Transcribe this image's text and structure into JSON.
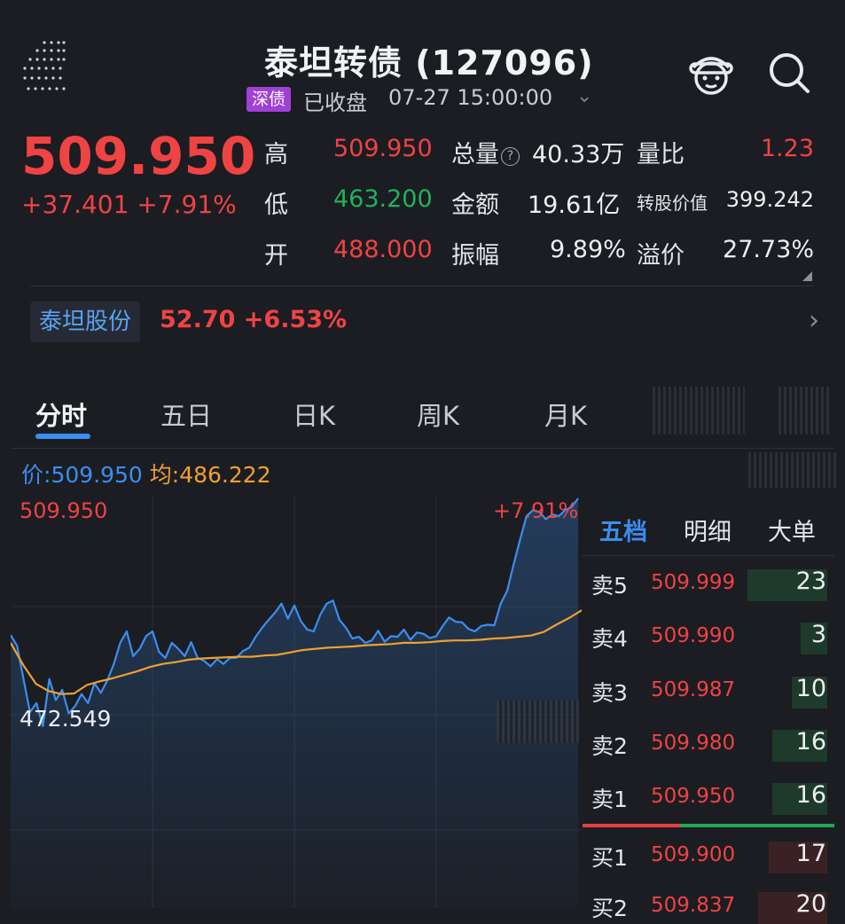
{
  "header": {
    "title": "泰坦转债 (127096)",
    "market_tag": "深债",
    "status": "已收盘",
    "time": "07-27 15:00:00"
  },
  "quote": {
    "price": "509.950",
    "change": "+37.401 +7.91%",
    "high_label": "高",
    "high": "509.950",
    "low_label": "低",
    "low": "463.200",
    "open_label": "开",
    "open": "488.000",
    "volume_label": "总量",
    "volume": "40.33万",
    "amount_label": "金额",
    "amount": "19.61亿",
    "amplitude_label": "振幅",
    "amplitude": "9.89%",
    "vol_ratio_label": "量比",
    "vol_ratio": "1.23",
    "conv_value_label": "转股价值",
    "conv_value": "399.242",
    "premium_label": "溢价",
    "premium": "27.73%"
  },
  "underlying": {
    "name": "泰坦股份",
    "price_change": "52.70 +6.53%"
  },
  "tabs": [
    "分时",
    "五日",
    "日K",
    "周K",
    "月K"
  ],
  "chart_header": {
    "price_label": "价:",
    "price": "509.950",
    "avg_label": "均:",
    "avg": "486.222"
  },
  "chart_data": {
    "type": "line",
    "y_top_label": "509.950",
    "y_bottom_label": "472.549",
    "pct_label": "+7.91%",
    "ylim": [
      463.2,
      509.95
    ],
    "series": [
      {
        "values": [
          487.3,
          485.5,
          480.0,
          474.5,
          476.0,
          472.2,
          480.0,
          476.5,
          478.2,
          474.3,
          475.5,
          477.5,
          476.0,
          479.3,
          477.7,
          479.8,
          482.5,
          486.0,
          487.9,
          483.8,
          485.0,
          487.1,
          487.9,
          484.5,
          483.5,
          486.0,
          485.0,
          483.8,
          486.1,
          483.5,
          483.0,
          482.1,
          483.3,
          482.5,
          483.5,
          483.5,
          484.6,
          485.2,
          487.0,
          488.5,
          489.8,
          491.0,
          492.5,
          490.0,
          492.2,
          489.6,
          488.2,
          487.9,
          490.6,
          492.5,
          493.0,
          489.8,
          488.5,
          486.7,
          487.0,
          486.0,
          486.4,
          488.0,
          486.2,
          487.1,
          487.0,
          488.2,
          486.5,
          487.7,
          487.5,
          486.8,
          487.1,
          488.8,
          490.2,
          489.5,
          489.4,
          488.3,
          487.9,
          488.8,
          489.0,
          488.9,
          492.5,
          494.6,
          499.0,
          503.1,
          507.0,
          508.0,
          507.7,
          506.5,
          507.3,
          507.0,
          508.0,
          508.5,
          509.95
        ]
      },
      {
        "values": [
          486.0,
          482.3,
          479.2,
          478.0,
          477.5,
          477.6,
          479.0,
          479.6,
          480.1,
          480.7,
          481.3,
          482.0,
          482.5,
          482.8,
          483.2,
          483.4,
          483.5,
          483.6,
          483.7,
          483.7,
          483.9,
          484.0,
          484.4,
          484.8,
          485.0,
          485.2,
          485.3,
          485.4,
          485.6,
          485.7,
          485.8,
          486.0,
          486.0,
          486.1,
          486.3,
          486.4,
          486.4,
          486.5,
          486.7,
          486.8,
          487.0,
          487.2,
          487.8,
          489.0,
          490.1,
          491.4
        ]
      }
    ]
  },
  "order_book": {
    "tabs": [
      "五档",
      "明细",
      "大单"
    ],
    "rows": [
      {
        "label": "卖5",
        "price": "509.999",
        "vol": "23",
        "share": 0.9
      },
      {
        "label": "卖4",
        "price": "509.990",
        "vol": "3",
        "share": 0.12
      },
      {
        "label": "卖3",
        "price": "509.987",
        "vol": "10",
        "share": 0.4
      },
      {
        "label": "卖2",
        "price": "509.980",
        "vol": "16",
        "share": 0.62
      },
      {
        "label": "卖1",
        "price": "509.950",
        "vol": "16",
        "share": 0.62
      },
      {
        "label": "买1",
        "price": "509.900",
        "vol": "17",
        "share": 0.66
      },
      {
        "label": "买2",
        "price": "509.837",
        "vol": "20",
        "share": 0.78
      }
    ]
  },
  "colors": {
    "up": "#f04343",
    "down": "#20b25a",
    "price_line": "#3a8ef2",
    "avg_line": "#f0a030"
  }
}
